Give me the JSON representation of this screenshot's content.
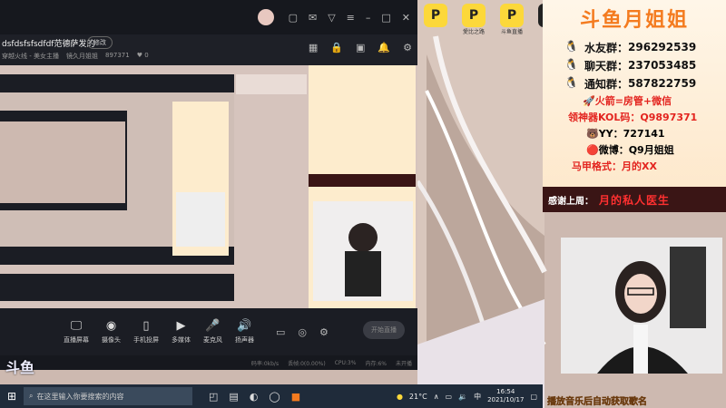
{
  "window": {
    "room_title": "dsfdsfsfsdfdf范德萨发的",
    "edit_label": "修改",
    "category": "穿越火线 - 美女主播",
    "streamer": "镜久月姐姐",
    "room_id": "897371",
    "likes": "0"
  },
  "controls": [
    {
      "label": "直播屏幕",
      "icon": "screen-icon"
    },
    {
      "label": "摄像头",
      "icon": "camera-icon"
    },
    {
      "label": "手机投屏",
      "icon": "phone-cast-icon"
    },
    {
      "label": "多媒体",
      "icon": "media-icon"
    },
    {
      "label": "麦克风",
      "icon": "mic-icon"
    },
    {
      "label": "扬声器",
      "icon": "speaker-icon"
    }
  ],
  "start_button": "开始直播",
  "status": [
    "码率:0kb/s",
    "丢帧:0(0.00%)",
    "CPU:3%",
    "内存:6%",
    "未开播"
  ],
  "apps": [
    {
      "label": "",
      "letter": "P"
    },
    {
      "label": "愛比之路",
      "letter": "P"
    },
    {
      "label": "斗鱼直播",
      "letter": "P"
    },
    {
      "label": "",
      "letter": "⚡"
    }
  ],
  "panel": {
    "title": "斗鱼月姐姐",
    "groups": [
      {
        "label": "水友群：",
        "value": "296292539"
      },
      {
        "label": "聊天群：",
        "value": "237053485"
      },
      {
        "label": "通知群：",
        "value": "587822759"
      }
    ],
    "fire": "火箭=房管+微信",
    "kol": "领神器KOL码：Q9897371",
    "yy": "YY：727141",
    "weibo": "微博：Q9月姐姐",
    "vest": "马甲格式：月的XX"
  },
  "thanks": {
    "label": "感谢上周：",
    "name": "月的私人医生"
  },
  "music": "播放音乐后自动获取歌名",
  "taskbar": {
    "search": "在这里输入你要搜索的内容",
    "temp": "21°C",
    "time": "16:54",
    "date": "2021/10/17"
  },
  "brand": "斗鱼",
  "colors": {
    "accent": "#f47b1f",
    "highlight": "#e3241f",
    "yellow": "#fcd83a"
  }
}
